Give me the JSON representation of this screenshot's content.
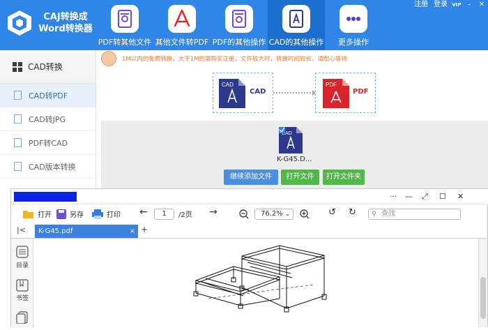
{
  "app": {
    "title_line1": "CAJ转换成",
    "title_line2": "Word转换器"
  },
  "top_links": {
    "register": "注册",
    "login": "登录",
    "vip": "VIP"
  },
  "nav": [
    {
      "label": "PDF转其他文件",
      "icon": "pdf-convert-icon"
    },
    {
      "label": "其他文件转PDF",
      "icon": "acrobat-icon"
    },
    {
      "label": "PDF的其他操作",
      "icon": "pdf-settings-icon"
    },
    {
      "label": "CAD的其他操作",
      "icon": "cad-icon"
    },
    {
      "label": "更多操作",
      "icon": "more-dots-icon"
    }
  ],
  "sidebar": {
    "header": "CAD转换",
    "items": [
      {
        "label": "CAD转PDF"
      },
      {
        "label": "CAD转JPG"
      },
      {
        "label": "PDF转CAD"
      },
      {
        "label": "CAD版本转换"
      }
    ]
  },
  "notice": "1M以内的免费转换，大于1M的需购买注册，文件较大时，转换时间较长，请耐心等待",
  "flow": {
    "from_tag": "CAD",
    "from_label": "CAD",
    "to_tag": "PDF",
    "to_label": "PDF"
  },
  "file": {
    "name": "K-G45.D...",
    "tag": "CAD"
  },
  "buttons": {
    "continue_add": "继续添加文件",
    "open_file": "打开文件",
    "open_folder": "打开文件夹"
  },
  "viewer": {
    "toolbar": {
      "open": "打开",
      "save_as": "另存",
      "print": "打印",
      "page_current": "1",
      "page_total": "/2页",
      "zoom": "76.2%",
      "search_placeholder": "查找"
    },
    "tab": {
      "name": "K-G45.pdf",
      "close": "×",
      "add": "+"
    },
    "left_panel": {
      "toc": "目录",
      "bookmark": "书签"
    },
    "window_controls": {
      "more": "···",
      "min": "—",
      "restore": "⤢",
      "max": "☐",
      "close": "✕"
    }
  },
  "colors": {
    "header_blue": "#2f86e6",
    "active_nav": "#1c6fcf",
    "notice_orange": "#f07d2e",
    "btn_blue": "#4a90e2",
    "btn_green": "#52b84a",
    "cad_blue": "#2d3a8c",
    "pdf_red": "#d6262b"
  }
}
